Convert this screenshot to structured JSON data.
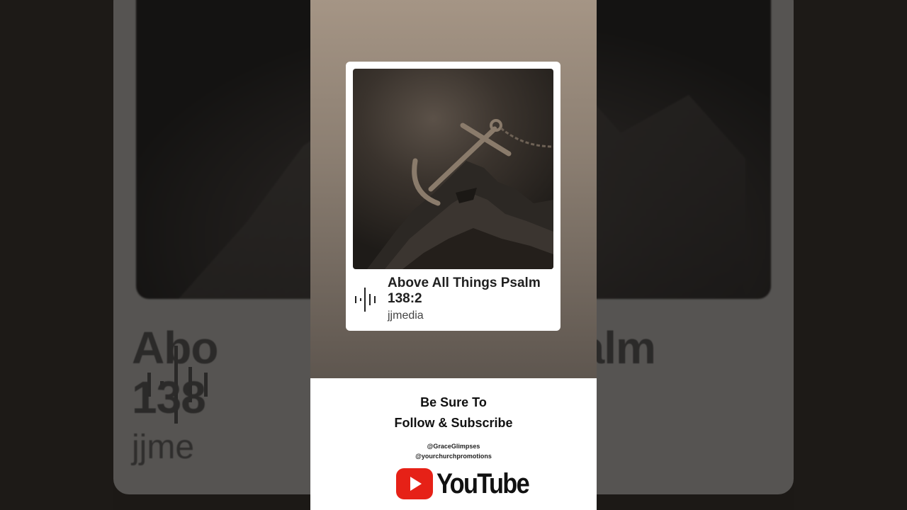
{
  "song": {
    "title": "Above All Things Psalm 138:2",
    "artist": "jjmedia"
  },
  "background": {
    "title_left": "Abo",
    "title_left_line2": "138",
    "title_right": "s Psalm",
    "artist_partial": "jjme"
  },
  "promo": {
    "line1": "Be Sure To",
    "line2": "Follow & Subscribe",
    "handle1": "@GraceGlimpses",
    "handle2": "@yourchurchpromotions",
    "youtube_label": "YouTube"
  },
  "icons": {
    "waveform": "audio-waveform-icon",
    "youtube": "youtube-play-icon"
  },
  "colors": {
    "youtube_red": "#e62117",
    "panel_top": "#a59585",
    "panel_bottom": "#5e564f"
  }
}
